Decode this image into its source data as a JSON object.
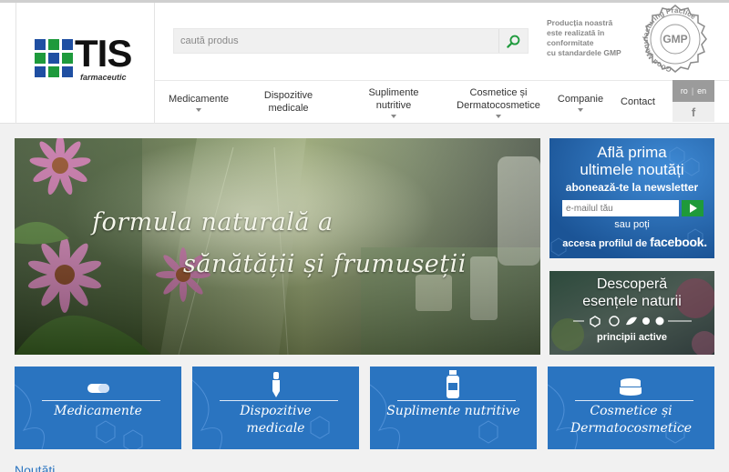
{
  "brand": {
    "name": "TIS",
    "sub": "farmaceutic",
    "colors": {
      "green": "#1e9a3c",
      "blue": "#1f4fa2",
      "dark": "#111111"
    }
  },
  "search": {
    "placeholder": "caută produs",
    "icon": "search-icon"
  },
  "gmp": {
    "lines": [
      "Producția noastră",
      "este realizată în",
      "conformitate",
      "cu standardele GMP"
    ],
    "seal_center": "GMP",
    "seal_ring": "Good Manufacturing Practice"
  },
  "nav": {
    "items": [
      {
        "label": "Medicamente",
        "dropdown": true
      },
      {
        "label": "Dispozitive\nmedicale",
        "dropdown": false
      },
      {
        "label": "Suplimente\nnutritive",
        "dropdown": true
      },
      {
        "label": "Cosmetice și\nDermatocosmetice",
        "dropdown": true
      },
      {
        "label": "Companie",
        "dropdown": true
      },
      {
        "label": "Contact",
        "dropdown": false
      }
    ]
  },
  "lang": {
    "ro": "ro",
    "sep": "|",
    "en": "en"
  },
  "social": {
    "facebook_glyph": "f"
  },
  "hero": {
    "line1": "formula naturală a",
    "line2": "sănătății și frumuseții"
  },
  "newsletter": {
    "line1": "Află prima",
    "line2": "ultimele noutăți",
    "line3": "abonează-te la newsletter",
    "placeholder": "e-mailul tău",
    "or": "sau poți",
    "profile_prefix": "accesa profilul de",
    "profile_brand": "facebook."
  },
  "natura": {
    "line1": "Descoperă",
    "line2": "esențele naturii",
    "line3": "principii active"
  },
  "categories": [
    {
      "label": "Medicamente",
      "icon": "pill-icon"
    },
    {
      "label": "Dispozitive\nmedicale",
      "icon": "dropper-icon"
    },
    {
      "label": "Suplimente nutritive",
      "icon": "bottle-icon"
    },
    {
      "label": "Cosmetice și\nDermatocosmetice",
      "icon": "cream-jar-icon"
    }
  ],
  "bottom": {
    "text": "Noutăți..."
  }
}
